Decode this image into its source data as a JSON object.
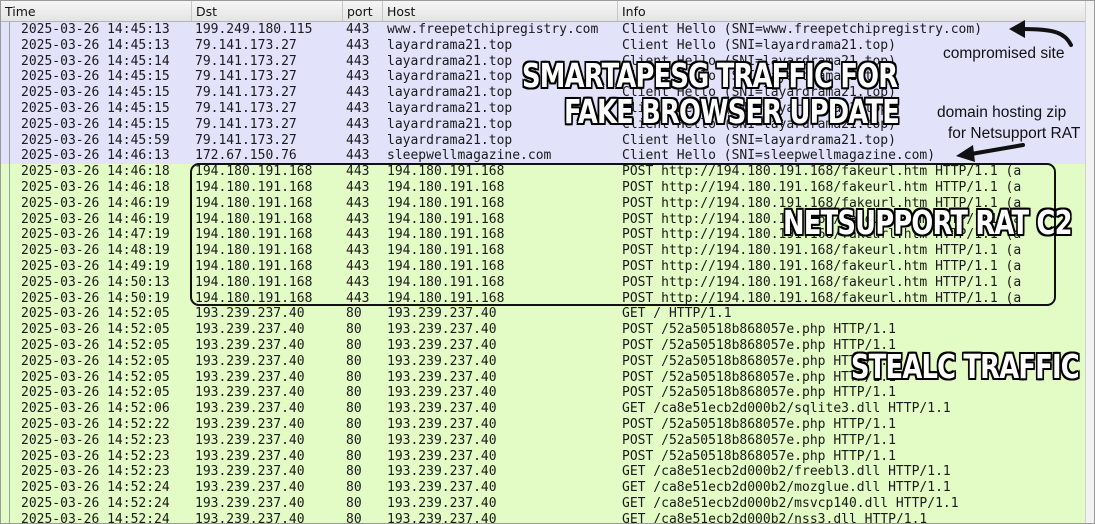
{
  "columns": [
    "Time",
    "Dst",
    "port",
    "Host",
    "Info"
  ],
  "rows": [
    {
      "type": "tls",
      "time": "2025-03-26 14:45:13",
      "dst": "199.249.180.115",
      "port": "443",
      "host": "www.freepetchipregistry.com",
      "info": "Client Hello (SNI=www.freepetchipregistry.com)"
    },
    {
      "type": "tls",
      "time": "2025-03-26 14:45:13",
      "dst": "79.141.173.27",
      "port": "443",
      "host": "layardrama21.top",
      "info": "Client Hello (SNI=layardrama21.top)"
    },
    {
      "type": "tls",
      "time": "2025-03-26 14:45:14",
      "dst": "79.141.173.27",
      "port": "443",
      "host": "layardrama21.top",
      "info": "Client Hello (SNI=layardrama21.top)"
    },
    {
      "type": "tls",
      "time": "2025-03-26 14:45:15",
      "dst": "79.141.173.27",
      "port": "443",
      "host": "layardrama21.top",
      "info": "Client Hello (SNI=layardrama21.top)"
    },
    {
      "type": "tls",
      "time": "2025-03-26 14:45:15",
      "dst": "79.141.173.27",
      "port": "443",
      "host": "layardrama21.top",
      "info": "Client Hello (SNI=layardrama21.top)"
    },
    {
      "type": "tls",
      "time": "2025-03-26 14:45:15",
      "dst": "79.141.173.27",
      "port": "443",
      "host": "layardrama21.top",
      "info": "Client Hello (SNI=layardrama21.top)"
    },
    {
      "type": "tls",
      "time": "2025-03-26 14:45:15",
      "dst": "79.141.173.27",
      "port": "443",
      "host": "layardrama21.top",
      "info": "Client Hello (SNI=layardrama21.top)"
    },
    {
      "type": "tls",
      "time": "2025-03-26 14:45:59",
      "dst": "79.141.173.27",
      "port": "443",
      "host": "layardrama21.top",
      "info": "Client Hello (SNI=layardrama21.top)"
    },
    {
      "type": "tls",
      "time": "2025-03-26 14:46:13",
      "dst": "172.67.150.76",
      "port": "443",
      "host": "sleepwellmagazine.com",
      "info": "Client Hello (SNI=sleepwellmagazine.com)"
    },
    {
      "type": "http",
      "time": "2025-03-26 14:46:18",
      "dst": "194.180.191.168",
      "port": "443",
      "host": "194.180.191.168",
      "info": "POST http://194.180.191.168/fakeurl.htm HTTP/1.1  (a"
    },
    {
      "type": "http",
      "time": "2025-03-26 14:46:18",
      "dst": "194.180.191.168",
      "port": "443",
      "host": "194.180.191.168",
      "info": "POST http://194.180.191.168/fakeurl.htm HTTP/1.1  (a"
    },
    {
      "type": "http",
      "time": "2025-03-26 14:46:19",
      "dst": "194.180.191.168",
      "port": "443",
      "host": "194.180.191.168",
      "info": "POST http://194.180.191.168/fakeurl.htm HTTP/1.1  (a"
    },
    {
      "type": "http",
      "time": "2025-03-26 14:46:19",
      "dst": "194.180.191.168",
      "port": "443",
      "host": "194.180.191.168",
      "info": "POST http://194.180.191.168/fakeurl.htm HTTP/1.1  (a"
    },
    {
      "type": "http",
      "time": "2025-03-26 14:47:19",
      "dst": "194.180.191.168",
      "port": "443",
      "host": "194.180.191.168",
      "info": "POST http://194.180.191.168/fakeurl.htm HTTP/1.1  (a"
    },
    {
      "type": "http",
      "time": "2025-03-26 14:48:19",
      "dst": "194.180.191.168",
      "port": "443",
      "host": "194.180.191.168",
      "info": "POST http://194.180.191.168/fakeurl.htm HTTP/1.1  (a"
    },
    {
      "type": "http",
      "time": "2025-03-26 14:49:19",
      "dst": "194.180.191.168",
      "port": "443",
      "host": "194.180.191.168",
      "info": "POST http://194.180.191.168/fakeurl.htm HTTP/1.1  (a"
    },
    {
      "type": "http",
      "time": "2025-03-26 14:50:13",
      "dst": "194.180.191.168",
      "port": "443",
      "host": "194.180.191.168",
      "info": "POST http://194.180.191.168/fakeurl.htm HTTP/1.1  (a"
    },
    {
      "type": "http",
      "time": "2025-03-26 14:50:19",
      "dst": "194.180.191.168",
      "port": "443",
      "host": "194.180.191.168",
      "info": "POST http://194.180.191.168/fakeurl.htm HTTP/1.1  (a"
    },
    {
      "type": "http",
      "time": "2025-03-26 14:52:05",
      "dst": "193.239.237.40",
      "port": "80",
      "host": "193.239.237.40",
      "info": "GET / HTTP/1.1"
    },
    {
      "type": "http",
      "time": "2025-03-26 14:52:05",
      "dst": "193.239.237.40",
      "port": "80",
      "host": "193.239.237.40",
      "info": "POST /52a50518b868057e.php HTTP/1.1"
    },
    {
      "type": "http",
      "time": "2025-03-26 14:52:05",
      "dst": "193.239.237.40",
      "port": "80",
      "host": "193.239.237.40",
      "info": "POST /52a50518b868057e.php HTTP/1.1"
    },
    {
      "type": "http",
      "time": "2025-03-26 14:52:05",
      "dst": "193.239.237.40",
      "port": "80",
      "host": "193.239.237.40",
      "info": "POST /52a50518b868057e.php HTTP/1.1"
    },
    {
      "type": "http",
      "time": "2025-03-26 14:52:05",
      "dst": "193.239.237.40",
      "port": "80",
      "host": "193.239.237.40",
      "info": "POST /52a50518b868057e.php HTTP/1.1"
    },
    {
      "type": "http",
      "time": "2025-03-26 14:52:05",
      "dst": "193.239.237.40",
      "port": "80",
      "host": "193.239.237.40",
      "info": "POST /52a50518b868057e.php HTTP/1.1"
    },
    {
      "type": "http",
      "time": "2025-03-26 14:52:06",
      "dst": "193.239.237.40",
      "port": "80",
      "host": "193.239.237.40",
      "info": "GET /ca8e51ecb2d000b2/sqlite3.dll HTTP/1.1"
    },
    {
      "type": "http",
      "time": "2025-03-26 14:52:22",
      "dst": "193.239.237.40",
      "port": "80",
      "host": "193.239.237.40",
      "info": "POST /52a50518b868057e.php HTTP/1.1"
    },
    {
      "type": "http",
      "time": "2025-03-26 14:52:23",
      "dst": "193.239.237.40",
      "port": "80",
      "host": "193.239.237.40",
      "info": "POST /52a50518b868057e.php HTTP/1.1"
    },
    {
      "type": "http",
      "time": "2025-03-26 14:52:23",
      "dst": "193.239.237.40",
      "port": "80",
      "host": "193.239.237.40",
      "info": "POST /52a50518b868057e.php HTTP/1.1"
    },
    {
      "type": "http",
      "time": "2025-03-26 14:52:23",
      "dst": "193.239.237.40",
      "port": "80",
      "host": "193.239.237.40",
      "info": "GET /ca8e51ecb2d000b2/freebl3.dll HTTP/1.1"
    },
    {
      "type": "http",
      "time": "2025-03-26 14:52:24",
      "dst": "193.239.237.40",
      "port": "80",
      "host": "193.239.237.40",
      "info": "GET /ca8e51ecb2d000b2/mozglue.dll HTTP/1.1"
    },
    {
      "type": "http",
      "time": "2025-03-26 14:52:24",
      "dst": "193.239.237.40",
      "port": "80",
      "host": "193.239.237.40",
      "info": "GET /ca8e51ecb2d000b2/msvcp140.dll HTTP/1.1"
    },
    {
      "type": "http",
      "time": "2025-03-26 14:52:24",
      "dst": "193.239.237.40",
      "port": "80",
      "host": "193.239.237.40",
      "info": "GET /ca8e51ecb2d000b2/nss3.dll HTTP/1.1"
    }
  ],
  "annotations": {
    "smartapesg_line1": "SMARTAPESG TRAFFIC FOR",
    "smartapesg_line2": "FAKE BROWSER UPDATE",
    "netsupport": "NETSUPPORT RAT C2",
    "stealc": "STEALC TRAFFIC",
    "compromised_site": "compromised site",
    "zip_note_line1": "domain hosting zip",
    "zip_note_line2": "for Netsupport RAT"
  },
  "colors": {
    "tls_row": "#e2e2fb",
    "http_row": "#e3fbc4"
  }
}
